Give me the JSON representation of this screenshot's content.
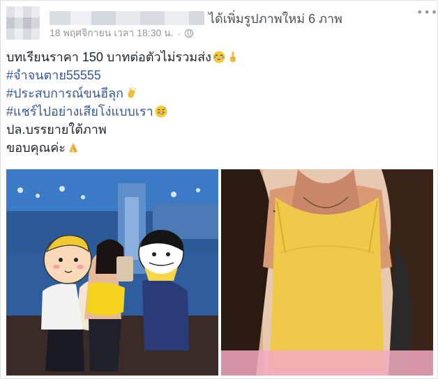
{
  "post": {
    "author_action": "ได้เพิ่มรูปภาพใหม่ 6 ภาพ",
    "timestamp": "18 พฤศจิกายน เวลา 18:30 น.",
    "separator": "·",
    "privacy_icon": "globe-icon",
    "menu_icon": "more-options-icon",
    "menu_glyph": "•••",
    "lines": [
      {
        "text": "บทเรียนราคา 150 บาทต่อตัวไม่รวมส่ง",
        "emojis": [
          "laughing-emoji",
          "finger-emoji"
        ]
      },
      {
        "text": "#จำจนตาย55555",
        "hashtag": true
      },
      {
        "text": "#ประสบการณ์ขนฮีลุก",
        "hashtag": true,
        "emojis": [
          "clapping-hands-emoji"
        ]
      },
      {
        "text": "#แชร์ไปอย่างเสียโง่แบบเรา",
        "hashtag": true,
        "emojis": [
          "grinning-sweat-emoji"
        ]
      },
      {
        "text": "ปล.บรรยายใต้ภาพ"
      },
      {
        "text": "ขอบคุณค่ะ",
        "emojis": [
          "praying-hands-emoji"
        ]
      }
    ]
  },
  "colors": {
    "link": "#365899",
    "text": "#1d2129",
    "meta": "#90949c",
    "border": "#dddfe2"
  }
}
